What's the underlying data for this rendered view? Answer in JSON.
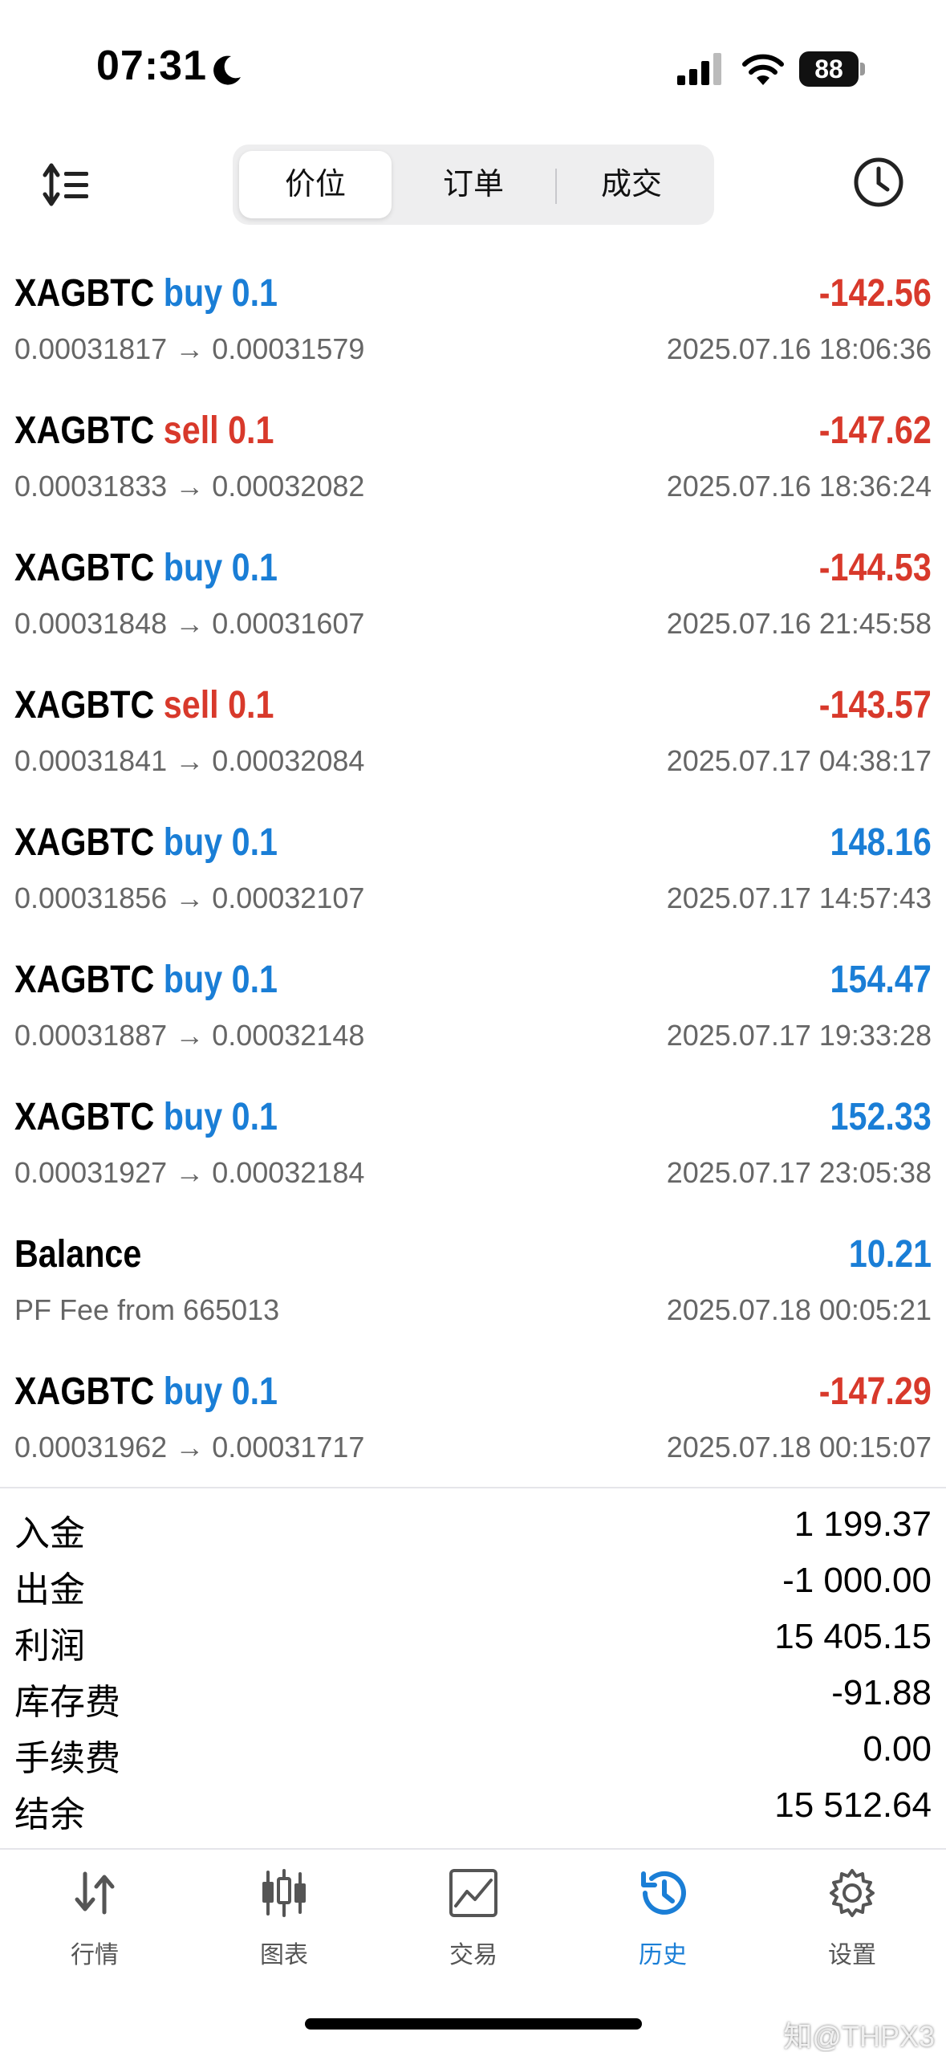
{
  "status_bar": {
    "time": "07:31",
    "battery": "88",
    "icons": [
      "moon-icon",
      "cellular-signal-icon",
      "wifi-icon",
      "battery-icon"
    ]
  },
  "toolbar": {
    "tabs": [
      {
        "label": "价位",
        "active": true
      },
      {
        "label": "订单",
        "active": false
      },
      {
        "label": "成交",
        "active": false
      }
    ],
    "icons": [
      "sort-icon",
      "clock-icon"
    ]
  },
  "deals": [
    {
      "symbol": "XAGBTC",
      "side": "buy 0.1",
      "side_type": "buy",
      "profit": "-142.56",
      "profit_sign": "neg",
      "prices": "0.00031817 → 0.00031579",
      "time": "2025.07.16 18:06:36"
    },
    {
      "symbol": "XAGBTC",
      "side": "sell 0.1",
      "side_type": "sell",
      "profit": "-147.62",
      "profit_sign": "neg",
      "prices": "0.00031833 → 0.00032082",
      "time": "2025.07.16 18:36:24"
    },
    {
      "symbol": "XAGBTC",
      "side": "buy 0.1",
      "side_type": "buy",
      "profit": "-144.53",
      "profit_sign": "neg",
      "prices": "0.00031848 → 0.00031607",
      "time": "2025.07.16 21:45:58"
    },
    {
      "symbol": "XAGBTC",
      "side": "sell 0.1",
      "side_type": "sell",
      "profit": "-143.57",
      "profit_sign": "neg",
      "prices": "0.00031841 → 0.00032084",
      "time": "2025.07.17 04:38:17"
    },
    {
      "symbol": "XAGBTC",
      "side": "buy 0.1",
      "side_type": "buy",
      "profit": "148.16",
      "profit_sign": "pos",
      "prices": "0.00031856 → 0.00032107",
      "time": "2025.07.17 14:57:43"
    },
    {
      "symbol": "XAGBTC",
      "side": "buy 0.1",
      "side_type": "buy",
      "profit": "154.47",
      "profit_sign": "pos",
      "prices": "0.00031887 → 0.00032148",
      "time": "2025.07.17 19:33:28"
    },
    {
      "symbol": "XAGBTC",
      "side": "buy 0.1",
      "side_type": "buy",
      "profit": "152.33",
      "profit_sign": "pos",
      "prices": "0.00031927 → 0.00032184",
      "time": "2025.07.17 23:05:38"
    },
    {
      "symbol": "Balance",
      "side": "",
      "side_type": "none",
      "profit": "10.21",
      "profit_sign": "pos",
      "prices": "PF Fee from 665013",
      "time": "2025.07.18 00:05:21"
    },
    {
      "symbol": "XAGBTC",
      "side": "buy 0.1",
      "side_type": "buy",
      "profit": "-147.29",
      "profit_sign": "neg",
      "prices": "0.00031962 → 0.00031717",
      "time": "2025.07.18 00:15:07"
    }
  ],
  "summary": [
    {
      "label": "入金",
      "value": "1 199.37"
    },
    {
      "label": "出金",
      "value": "-1 000.00"
    },
    {
      "label": "利润",
      "value": "15 405.15"
    },
    {
      "label": "库存费",
      "value": "-91.88"
    },
    {
      "label": "手续费",
      "value": "0.00"
    },
    {
      "label": "结余",
      "value": "15 512.64"
    }
  ],
  "tabbar": [
    {
      "label": "行情",
      "icon": "quotes-arrows-icon",
      "active": false
    },
    {
      "label": "图表",
      "icon": "candlestick-chart-icon",
      "active": false
    },
    {
      "label": "交易",
      "icon": "trade-chart-icon",
      "active": false
    },
    {
      "label": "历史",
      "icon": "history-icon",
      "active": true
    },
    {
      "label": "设置",
      "icon": "settings-gear-icon",
      "active": false
    }
  ],
  "watermark": "知@THPX3",
  "colors": {
    "accent_blue": "#1a7ed6",
    "loss_red": "#d8392b",
    "secondary_text": "#666666"
  }
}
